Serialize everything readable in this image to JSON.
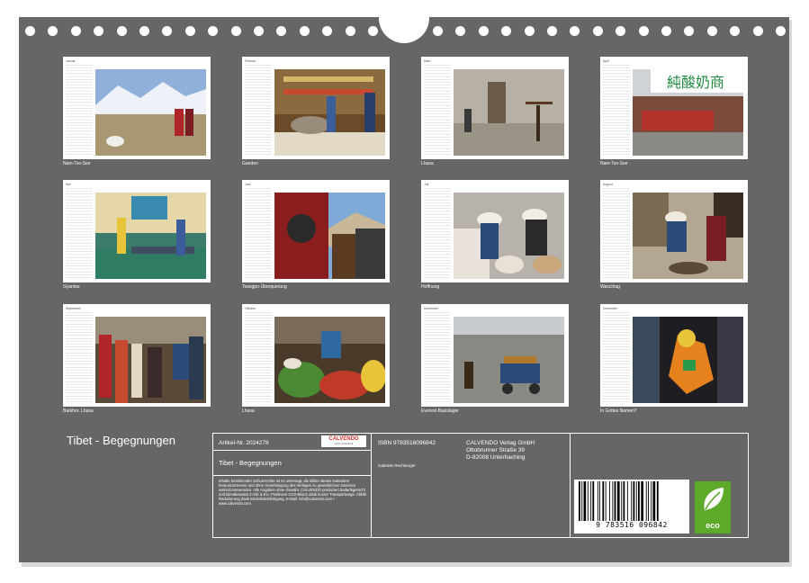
{
  "calendar_title": "Tibet - Begegnungen",
  "months": [
    {
      "name": "Januar",
      "caption": "Nam-Tso-See"
    },
    {
      "name": "Februar",
      "caption": "Ganden"
    },
    {
      "name": "März",
      "caption": "Lhasa"
    },
    {
      "name": "April",
      "caption": "Nam-Tso-See"
    },
    {
      "name": "Mai",
      "caption": "Gyantse"
    },
    {
      "name": "Juni",
      "caption": "Tsangpo-Überquerung"
    },
    {
      "name": "Juli",
      "caption": "Hoffnung"
    },
    {
      "name": "August",
      "caption": "Waschtag"
    },
    {
      "name": "September",
      "caption": "Barkhor, Lhasa"
    },
    {
      "name": "Oktober",
      "caption": "Lhasa"
    },
    {
      "name": "November",
      "caption": "Everest-Basislager"
    },
    {
      "name": "Dezember",
      "caption": "In Gottes Namen?"
    }
  ],
  "info": {
    "article_nr": "Artikel-Nr. 2024278",
    "logo_text": "CALVENDO",
    "logo_tag": "Jetzt individuell",
    "product_title": "Tibet - Begegnungen",
    "legal_text": "Inhalte bestehender Schutzrechte ist es untersagt, die Bilder dieses Kalenders herauszutrennen und ohne Genehmigung des Verlages zu gewerblichen Zwecken weiterzuverwenden. Alle Angaben ohne Gewähr. CALVENDO produziert bedarfsgerecht und klimabewusst in DE & EU. Positivere CO2-Bilanz dank kurzer Transportwege. Abfall-Reduzierung dank Einzelstückfertigung. E-Mail: info@calvendo.com • www.calvendo.com",
    "isbn": "ISBN 9783516096842",
    "author": "Gabriele Rechberger",
    "publisher_name": "CALVENDO Verlag GmbH",
    "publisher_street": "Ottobrunner Straße 39",
    "publisher_city": "D-82008 Unterhaching",
    "barcode_digits": "9 783516 096842",
    "eco_label": "eco"
  }
}
